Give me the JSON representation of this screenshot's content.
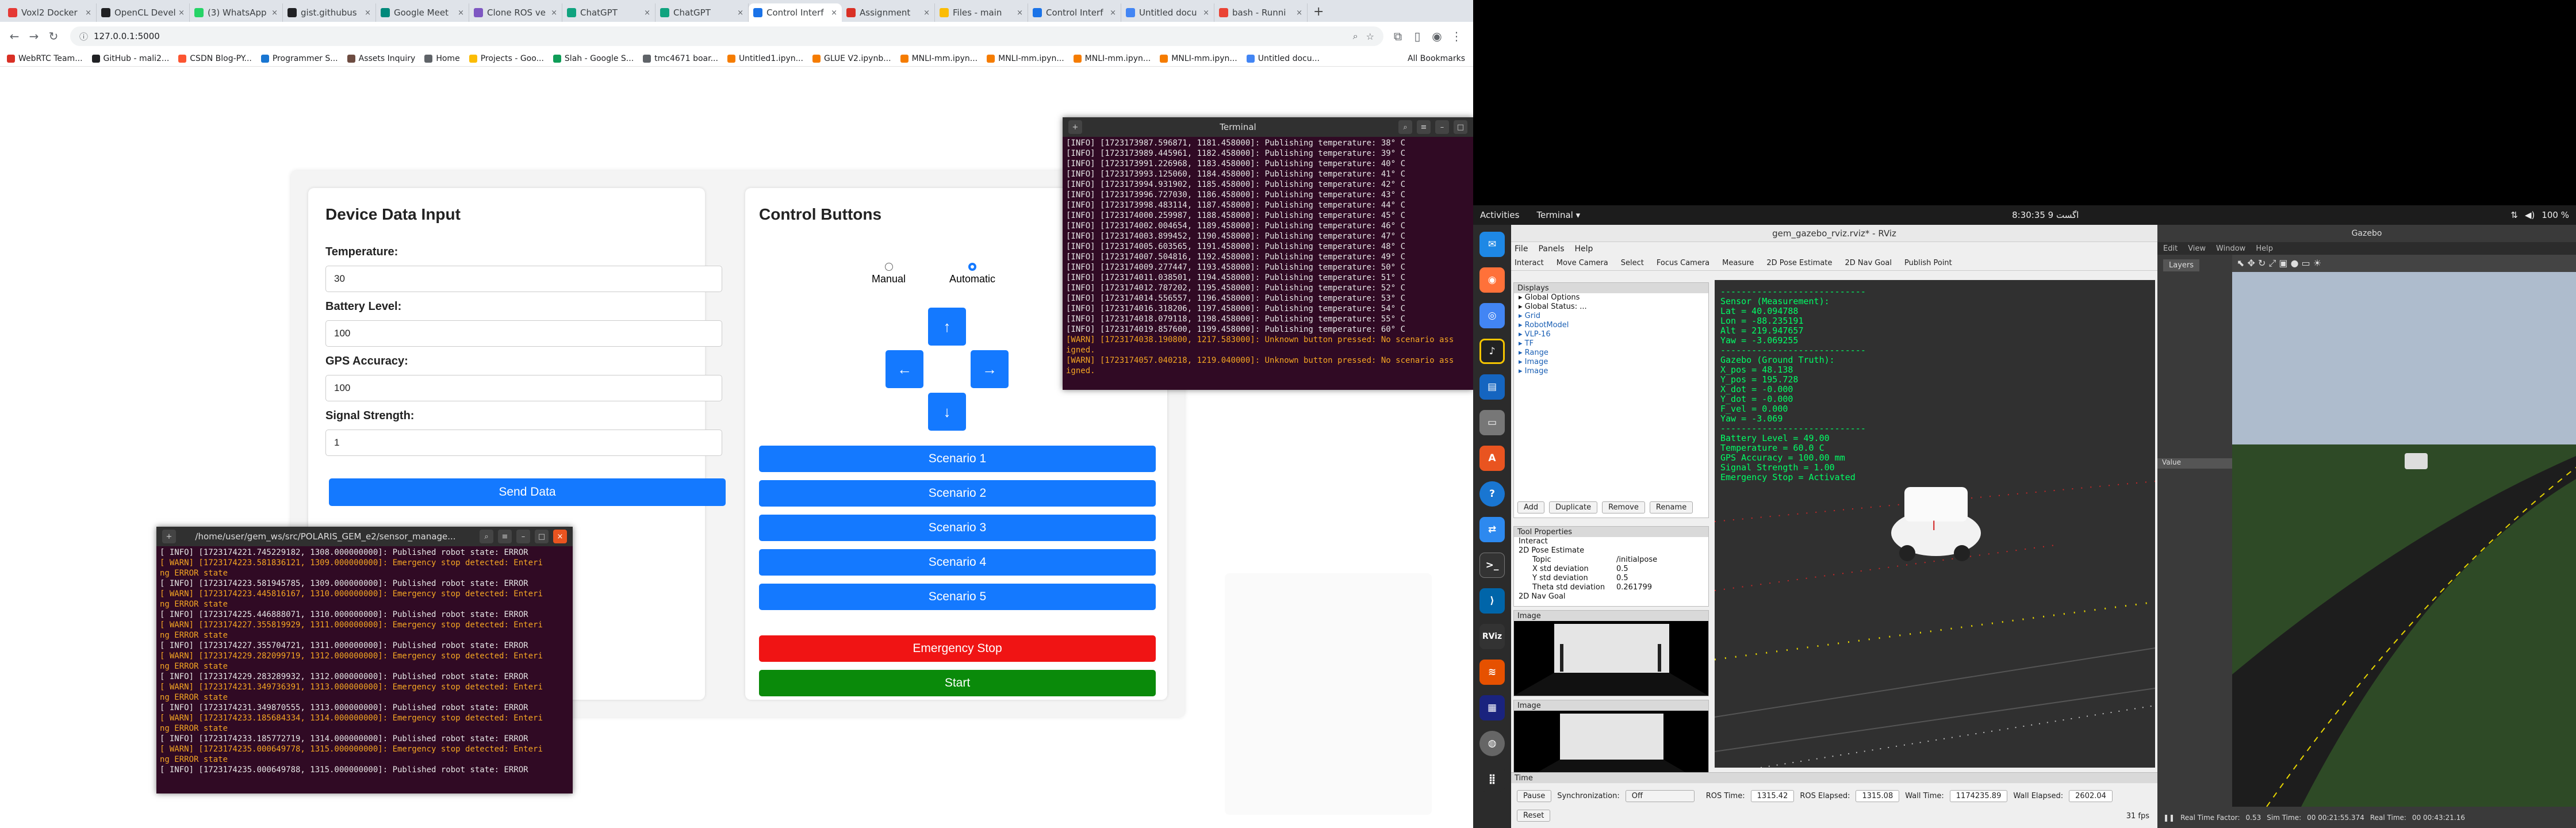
{
  "browser": {
    "tabs": [
      {
        "title": "Voxl2 Docker",
        "color": "#e53935"
      },
      {
        "title": "OpenCL Devel",
        "color": "#202124"
      },
      {
        "title": "(3) WhatsApp",
        "color": "#25d366"
      },
      {
        "title": "gist.githubus",
        "color": "#202124"
      },
      {
        "title": "Google Meet",
        "color": "#00897b"
      },
      {
        "title": "Clone ROS ve",
        "color": "#7e57c2"
      },
      {
        "title": "ChatGPT",
        "color": "#10a37f"
      },
      {
        "title": "ChatGPT",
        "color": "#10a37f"
      },
      {
        "title": "Control Interf",
        "color": "#1a73e8",
        "active": true
      },
      {
        "title": "Assignment",
        "color": "#d93025"
      },
      {
        "title": "Files - main",
        "color": "#fbbc04"
      },
      {
        "title": "Control Interf",
        "color": "#1a73e8"
      },
      {
        "title": "Untitled docu",
        "color": "#4285f4"
      },
      {
        "title": "bash - Runni",
        "color": "#ea4335"
      }
    ],
    "url": "127.0.0.1:5000",
    "bookmarks": [
      {
        "label": "WebRTC Team...",
        "color": "#d93025"
      },
      {
        "label": "GitHub - mali2...",
        "color": "#202124"
      },
      {
        "label": "CSDN Blog-PY...",
        "color": "#fc5531"
      },
      {
        "label": "Programmer S...",
        "color": "#1976d2"
      },
      {
        "label": "Assets Inquiry",
        "color": "#6d4c41"
      },
      {
        "label": "Home",
        "color": "#5f6368"
      },
      {
        "label": "Projects - Goo...",
        "color": "#fbbc04"
      },
      {
        "label": "Slah - Google S...",
        "color": "#0f9d58"
      },
      {
        "label": "tmc4671 boar...",
        "color": "#5f6368"
      },
      {
        "label": "Untitled1.ipyn...",
        "color": "#f57c00"
      },
      {
        "label": "GLUE V2.ipynb...",
        "color": "#f57c00"
      },
      {
        "label": "MNLI-mm.ipyn...",
        "color": "#f57c00"
      },
      {
        "label": "MNLI-mm.ipyn...",
        "color": "#f57c00"
      },
      {
        "label": "MNLI-mm.ipyn...",
        "color": "#f57c00"
      },
      {
        "label": "MNLI-mm.ipyn...",
        "color": "#f57c00"
      },
      {
        "label": "Untitled docu...",
        "color": "#4285f4"
      }
    ],
    "all_bookmarks": "All Bookmarks"
  },
  "app": {
    "device_title": "Device Data Input",
    "temperature_label": "Temperature:",
    "temperature_value": "30",
    "battery_label": "Battery Level:",
    "battery_value": "100",
    "gps_label": "GPS Accuracy:",
    "gps_value": "100",
    "signal_label": "Signal Strength:",
    "signal_value": "1",
    "send_label": "Send Data",
    "control_title": "Control Buttons",
    "manual_label": "Manual",
    "automatic_label": "Automatic",
    "mode_selected": "Automatic",
    "up": "↑",
    "left": "←",
    "right": "→",
    "down": "↓",
    "scenarios": [
      "Scenario 1",
      "Scenario 2",
      "Scenario 3",
      "Scenario 4",
      "Scenario 5"
    ],
    "emergency_label": "Emergency Stop",
    "start_label": "Start",
    "colors": {
      "blue": "#1479ff",
      "red": "#f01414",
      "green": "#0a8a0a"
    }
  },
  "terminal_top": {
    "title": "Terminal",
    "lines": [
      {
        "t": "[INFO] [1723173987.596871, 1181.458000]: Publishing temperature: 38° C",
        "w": false
      },
      {
        "t": "[INFO] [1723173989.445961, 1182.458000]: Publishing temperature: 39° C",
        "w": false
      },
      {
        "t": "[INFO] [1723173991.226968, 1183.458000]: Publishing temperature: 40° C",
        "w": false
      },
      {
        "t": "[INFO] [1723173993.125060, 1184.458000]: Publishing temperature: 41° C",
        "w": false
      },
      {
        "t": "[INFO] [1723173994.931902, 1185.458000]: Publishing temperature: 42° C",
        "w": false
      },
      {
        "t": "[INFO] [1723173996.727030, 1186.458000]: Publishing temperature: 43° C",
        "w": false
      },
      {
        "t": "[INFO] [1723173998.483114, 1187.458000]: Publishing temperature: 44° C",
        "w": false
      },
      {
        "t": "[INFO] [1723174000.259987, 1188.458000]: Publishing temperature: 45° C",
        "w": false
      },
      {
        "t": "[INFO] [1723174002.004654, 1189.458000]: Publishing temperature: 46° C",
        "w": false
      },
      {
        "t": "[INFO] [1723174003.899452, 1190.458000]: Publishing temperature: 47° C",
        "w": false
      },
      {
        "t": "[INFO] [1723174005.603565, 1191.458000]: Publishing temperature: 48° C",
        "w": false
      },
      {
        "t": "[INFO] [1723174007.504816, 1192.458000]: Publishing temperature: 49° C",
        "w": false
      },
      {
        "t": "[INFO] [1723174009.277447, 1193.458000]: Publishing temperature: 50° C",
        "w": false
      },
      {
        "t": "[INFO] [1723174011.038501, 1194.458000]: Publishing temperature: 51° C",
        "w": false
      },
      {
        "t": "[INFO] [1723174012.787202, 1195.458000]: Publishing temperature: 52° C",
        "w": false
      },
      {
        "t": "[INFO] [1723174014.556557, 1196.458000]: Publishing temperature: 53° C",
        "w": false
      },
      {
        "t": "[INFO] [1723174016.318206, 1197.458000]: Publishing temperature: 54° C",
        "w": false
      },
      {
        "t": "[INFO] [1723174018.079118, 1198.458000]: Publishing temperature: 55° C",
        "w": false
      },
      {
        "t": "[INFO] [1723174019.857600, 1199.458000]: Publishing temperature: 60° C",
        "w": false
      },
      {
        "t": "[WARN] [1723174038.190800, 1217.583000]: Unknown button pressed: No scenario ass",
        "w": true
      },
      {
        "t": "igned.",
        "w": true
      },
      {
        "t": "[WARN] [1723174057.040218, 1219.040000]: Unknown button pressed: No scenario ass",
        "w": true
      },
      {
        "t": "igned.",
        "w": true
      }
    ]
  },
  "terminal_bottom": {
    "title": "/home/user/gem_ws/src/POLARIS_GEM_e2/sensor_manage...",
    "lines": [
      {
        "t": "[ INFO] [1723174221.745229182, 1308.000000000]: Published robot state: ERROR",
        "w": false
      },
      {
        "t": "[ WARN] [1723174223.581836121, 1309.000000000]: Emergency stop detected: Enteri",
        "w": true
      },
      {
        "t": "ng ERROR state",
        "w": true
      },
      {
        "t": "[ INFO] [1723174223.581945785, 1309.000000000]: Published robot state: ERROR",
        "w": false
      },
      {
        "t": "[ WARN] [1723174223.445816167, 1310.000000000]: Emergency stop detected: Enteri",
        "w": true
      },
      {
        "t": "ng ERROR state",
        "w": true
      },
      {
        "t": "[ INFO] [1723174225.446888071, 1310.000000000]: Published robot state: ERROR",
        "w": false
      },
      {
        "t": "[ WARN] [1723174227.355819929, 1311.000000000]: Emergency stop detected: Enteri",
        "w": true
      },
      {
        "t": "ng ERROR state",
        "w": true
      },
      {
        "t": "[ INFO] [1723174227.355704721, 1311.000000000]: Published robot state: ERROR",
        "w": false
      },
      {
        "t": "[ WARN] [1723174229.282099719, 1312.000000000]: Emergency stop detected: Enteri",
        "w": true
      },
      {
        "t": "ng ERROR state",
        "w": true
      },
      {
        "t": "[ INFO] [1723174229.283289932, 1312.000000000]: Published robot state: ERROR",
        "w": false
      },
      {
        "t": "[ WARN] [1723174231.349736391, 1313.000000000]: Emergency stop detected: Enteri",
        "w": true
      },
      {
        "t": "ng ERROR state",
        "w": true
      },
      {
        "t": "[ INFO] [1723174231.349870555, 1313.000000000]: Published robot state: ERROR",
        "w": false
      },
      {
        "t": "[ WARN] [1723174233.185684334, 1314.000000000]: Emergency stop detected: Enteri",
        "w": true
      },
      {
        "t": "ng ERROR state",
        "w": true
      },
      {
        "t": "[ INFO] [1723174233.185772719, 1314.000000000]: Published robot state: ERROR",
        "w": false
      },
      {
        "t": "[ WARN] [1723174235.000649778, 1315.000000000]: Emergency stop detected: Enteri",
        "w": true
      },
      {
        "t": "ng ERROR state",
        "w": true
      },
      {
        "t": "[ INFO] [1723174235.000649788, 1315.000000000]: Published robot state: ERROR",
        "w": false
      }
    ]
  },
  "desktop": {
    "activities": "Activities",
    "terminal_menu": "Terminal ▾",
    "clock": "8:30:35  9 اگست",
    "battery": "100 %",
    "rviz_title": "gem_gazebo_rviz.rviz* - RViz",
    "rviz_menus": [
      "File",
      "Panels",
      "Help"
    ],
    "rviz_tools": [
      "Interact",
      "Move Camera",
      "Select",
      "Focus Camera",
      "Measure",
      "2D Pose Estimate",
      "2D Nav Goal",
      "Publish Point"
    ],
    "displays_header": "Displays",
    "displays": [
      "Global Options",
      "Global Status: ...",
      "Grid",
      "RobotModel",
      "VLP-16",
      "TF",
      "Range",
      "Image",
      "Image"
    ],
    "display_buttons": [
      "Add",
      "Duplicate",
      "Remove",
      "Rename"
    ],
    "tool_props_header": "Tool Properties",
    "tool_props": [
      {
        "k": "Interact",
        "v": ""
      },
      {
        "k": "2D Pose Estimate",
        "v": ""
      },
      {
        "k": "Topic",
        "v": "/initialpose"
      },
      {
        "k": "X std deviation",
        "v": "0.5"
      },
      {
        "k": "Y std deviation",
        "v": "0.5"
      },
      {
        "k": "Theta std deviation",
        "v": "0.261799"
      },
      {
        "k": "2D Nav Goal",
        "v": ""
      }
    ],
    "image_header": "Image",
    "sensor_text": [
      "----------------------------",
      "Sensor (Measurement):",
      "Lat = 40.094788",
      "Lon = -88.235191",
      "Alt = 219.947657",
      "Yaw = -3.069255",
      "----------------------------",
      "Gazebo (Ground Truth):",
      "X_pos = 48.138",
      "Y_pos = 195.728",
      "X_dot = -0.000",
      "Y_dot = -0.000",
      "F_vel = 0.000",
      "Yaw = -3.069",
      "----------------------------",
      "Battery Level = 49.00",
      "Temperature = 60.0 C",
      "GPS Accuracy = 100.00 mm",
      "Signal Strength = 1.00",
      "Emergency Stop = Activated"
    ],
    "time_header": "Time",
    "pause": "Pause",
    "sync_label": "Synchronization:",
    "sync_value": "Off",
    "ros_time_label": "ROS Time:",
    "ros_time": "1315.42",
    "ros_elapsed_label": "ROS Elapsed:",
    "ros_elapsed": "1315.08",
    "wall_time_label": "Wall Time:",
    "wall_time": "1174235.89",
    "wall_elapsed_label": "Wall Elapsed:",
    "wall_elapsed": "2602.04",
    "reset": "Reset",
    "fps": "31 fps",
    "gazebo_title": "Gazebo",
    "gazebo_menus": [
      "Edit",
      "View",
      "Window",
      "Help"
    ],
    "gazebo_layers": "Layers",
    "gazebo_value": "Value",
    "gazebo_rtf_label": "Real Time Factor:",
    "gazebo_rtf": "0.53",
    "gazebo_sim_label": "Sim Time:",
    "gazebo_sim": "00 00:21:55.374",
    "gazebo_real_label": "Real Time:",
    "gazebo_real": "00 00:43:21.16"
  }
}
